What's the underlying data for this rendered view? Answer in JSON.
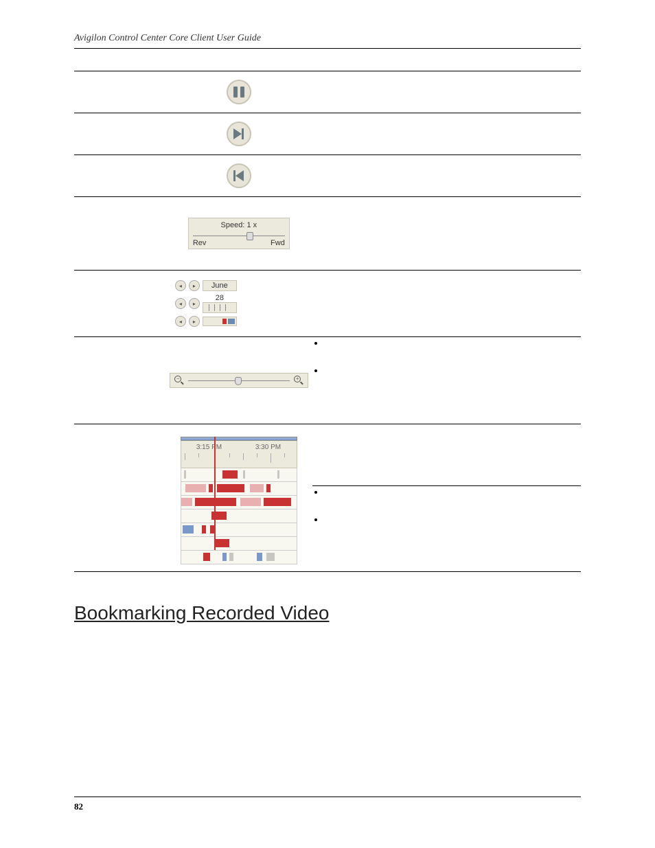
{
  "header": {
    "title": "Avigilon Control Center Core Client User Guide"
  },
  "speed": {
    "label": "Speed: 1 x",
    "rev": "Rev",
    "fwd": "Fwd"
  },
  "calendar": {
    "month": "June",
    "day": "28"
  },
  "timeline": {
    "t1": "3:15 PM",
    "t2": "3:30 PM"
  },
  "section": {
    "heading": "Bookmarking Recorded Video"
  },
  "footer": {
    "page": "82"
  }
}
